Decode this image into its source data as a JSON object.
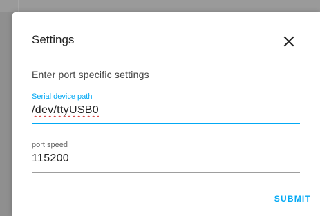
{
  "dialog": {
    "title": "Settings",
    "subtitle": "Enter port specific settings",
    "close_icon": "close-icon"
  },
  "fields": {
    "serial": {
      "label": "Serial device path",
      "value": "/dev/ttyUSB0"
    },
    "speed": {
      "label": "port speed",
      "value": "115200"
    }
  },
  "actions": {
    "submit_label": "SUBMIT"
  },
  "colors": {
    "accent": "#03a9f4",
    "spellcheck": "#d32f2f"
  }
}
